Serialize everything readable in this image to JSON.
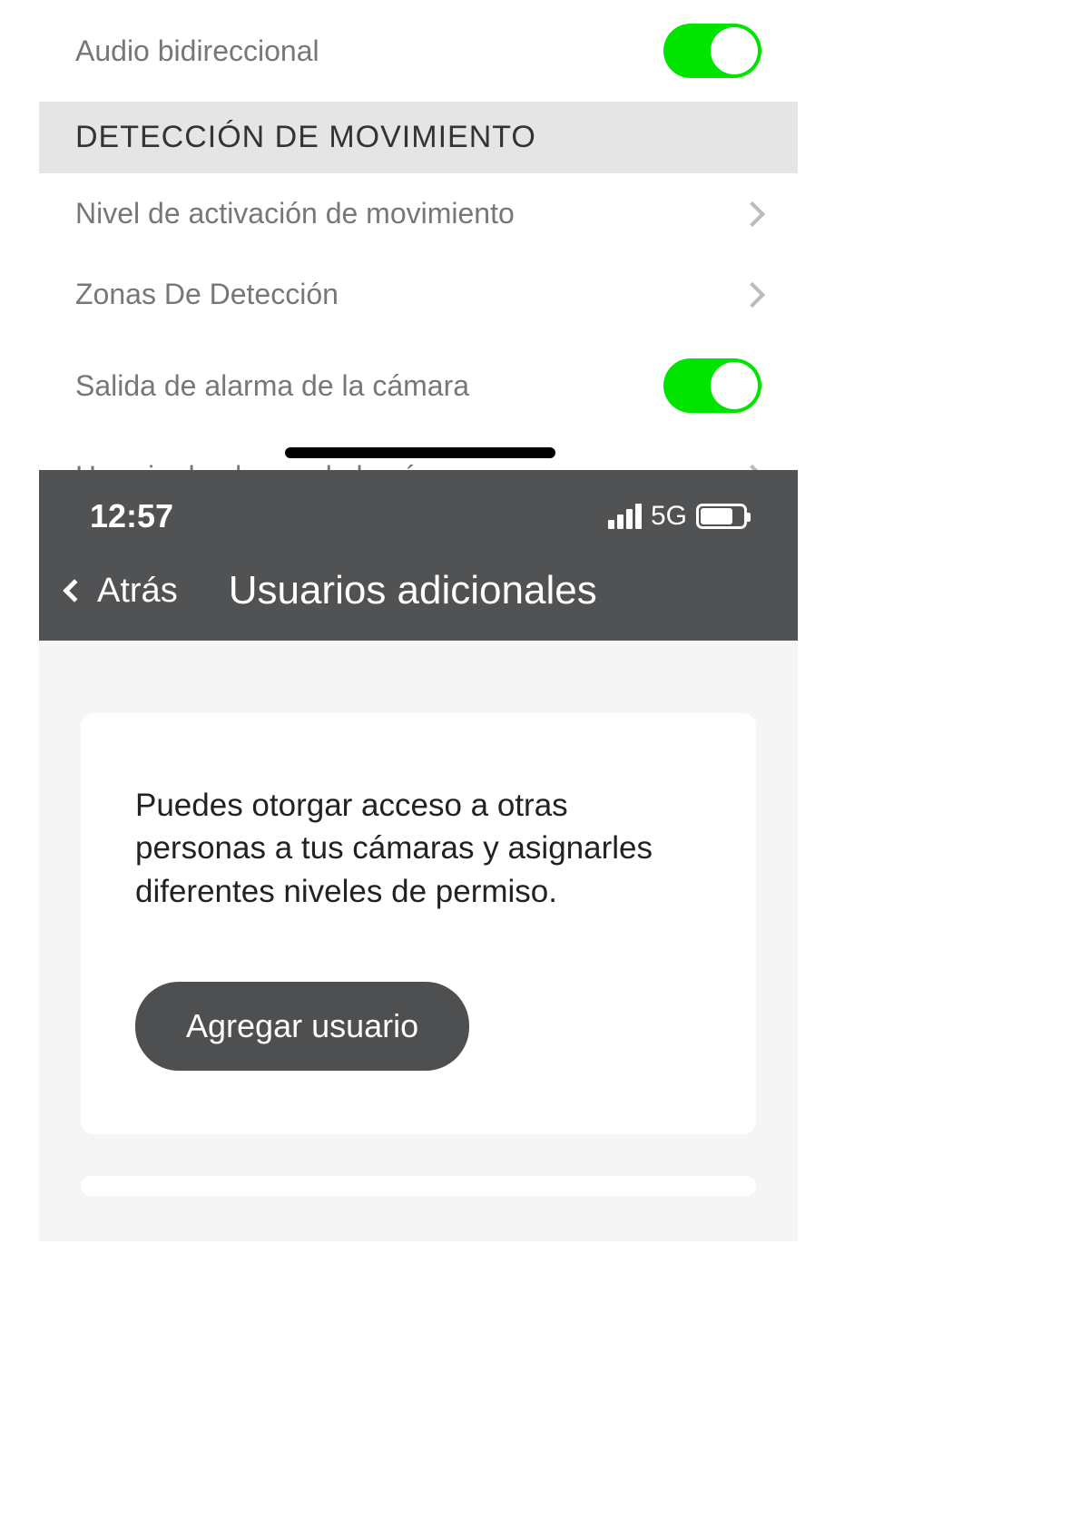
{
  "settings": {
    "audio_row": {
      "label": "Audio bidireccional",
      "enabled": true
    },
    "section_motion": "DETECCIÓN DE MOVIMIENTO",
    "motion_level": {
      "label": "Nivel de activación de movimiento"
    },
    "detection_zones": {
      "label": "Zonas De Detección"
    },
    "camera_alarm_output": {
      "label": "Salida de alarma de la cámara",
      "enabled": true
    },
    "camera_alarm_schedule": {
      "label": "Horario de alarma de la cámara"
    }
  },
  "overlay": {
    "status": {
      "time": "12:57",
      "network": "5G"
    },
    "nav": {
      "back": "Atrás",
      "title": "Usuarios adicionales"
    },
    "card": {
      "description": "Puedes otorgar acceso a otras personas a tus cámaras y asignarles diferentes niveles de permiso.",
      "add_button": "Agregar usuario"
    }
  }
}
